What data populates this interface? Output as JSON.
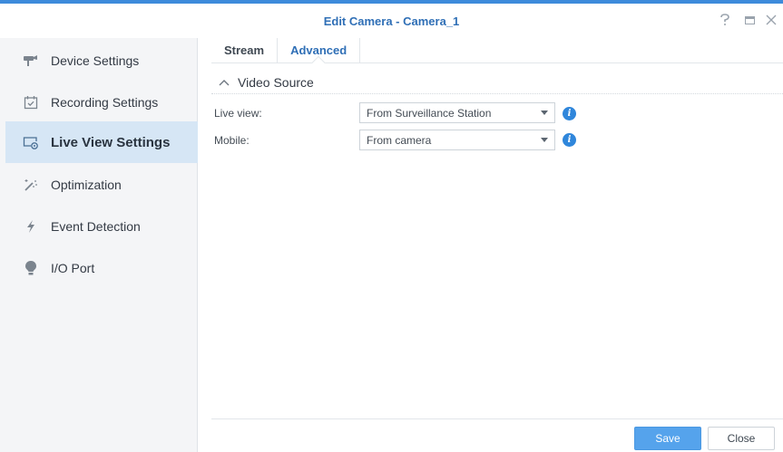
{
  "window": {
    "title": "Edit Camera - Camera_1",
    "accent_color": "#3d8bdb",
    "controls": [
      "help-icon",
      "maximize-icon",
      "close-icon"
    ]
  },
  "sidebar": {
    "items": [
      {
        "label": "Device Settings",
        "icon": "camera-icon",
        "active": false
      },
      {
        "label": "Recording Settings",
        "icon": "calendar-check-icon",
        "active": false
      },
      {
        "label": "Live View Settings",
        "icon": "live-view-icon",
        "active": true
      },
      {
        "label": "Optimization",
        "icon": "magic-wand-icon",
        "active": false
      },
      {
        "label": "Event Detection",
        "icon": "lightning-icon",
        "active": false
      },
      {
        "label": "I/O Port",
        "icon": "bulb-icon",
        "active": false
      }
    ],
    "active_color": "#d6e6f5"
  },
  "tabs": [
    {
      "label": "Stream",
      "active": false
    },
    {
      "label": "Advanced",
      "active": true
    }
  ],
  "section": {
    "title": "Video Source",
    "expanded": true
  },
  "fields": [
    {
      "label": "Live view:",
      "value": "From Surveillance Station"
    },
    {
      "label": "Mobile:",
      "value": "From camera"
    }
  ],
  "footer": {
    "save_label": "Save",
    "close_label": "Close",
    "save_color": "#55a3ec"
  }
}
